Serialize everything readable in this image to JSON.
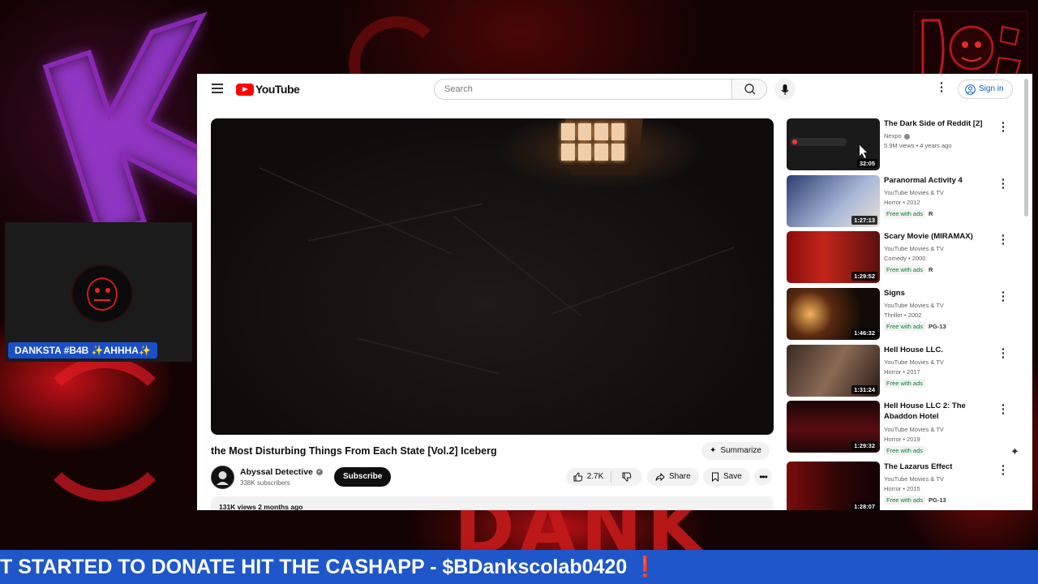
{
  "overlay": {
    "cam_name": "DANKSTA #B4B ✨AHHHA✨",
    "ticker": "T STARTED TO DONATE HIT THE CASHAPP - $BDankscolab0420 ❗"
  },
  "youtube": {
    "logo_text": "YouTube",
    "search_placeholder": "Search",
    "signin_label": "Sign in",
    "video": {
      "title": "the Most Disturbing Things From Each State [Vol.2] Iceberg",
      "summarize_label": "Summarize",
      "channel": "Abyssal Detective",
      "subscribers": "338K subscribers",
      "subscribe_label": "Subscribe",
      "likes": "2.7K",
      "share_label": "Share",
      "save_label": "Save",
      "description": "131K views  2 months ago"
    },
    "recommended": [
      {
        "title": "The Dark Side of Reddit [2]",
        "channel": "Nexpo",
        "meta": "5.9M views • 4 years ago",
        "duration": "32:05",
        "free": "",
        "rating": ""
      },
      {
        "title": "Paranormal Activity 4",
        "channel": "YouTube Movies & TV",
        "meta": "Horror • 2012",
        "duration": "1:27:13",
        "free": "Free with ads",
        "rating": "R"
      },
      {
        "title": "Scary Movie (MIRAMAX)",
        "channel": "YouTube Movies & TV",
        "meta": "Comedy • 2000",
        "duration": "1:29:52",
        "free": "Free with ads",
        "rating": "R"
      },
      {
        "title": "Signs",
        "channel": "YouTube Movies & TV",
        "meta": "Thriller • 2002",
        "duration": "1:46:32",
        "free": "Free with ads",
        "rating": "PG-13"
      },
      {
        "title": "Hell House LLC.",
        "channel": "YouTube Movies & TV",
        "meta": "Horror • 2017",
        "duration": "1:31:24",
        "free": "Free with ads",
        "rating": ""
      },
      {
        "title": "Hell House LLC 2: The Abaddon Hotel",
        "channel": "YouTube Movies & TV",
        "meta": "Horror • 2019",
        "duration": "1:29:32",
        "free": "Free with ads",
        "rating": ""
      },
      {
        "title": "The Lazarus Effect",
        "channel": "YouTube Movies & TV",
        "meta": "Horror • 2015",
        "duration": "1:28:07",
        "free": "Free with ads",
        "rating": "PG-13"
      }
    ]
  },
  "colors": {
    "ticker_bg": "#1f56c9",
    "yt_red": "#ff0000",
    "free_green": "#0b7d2f"
  }
}
